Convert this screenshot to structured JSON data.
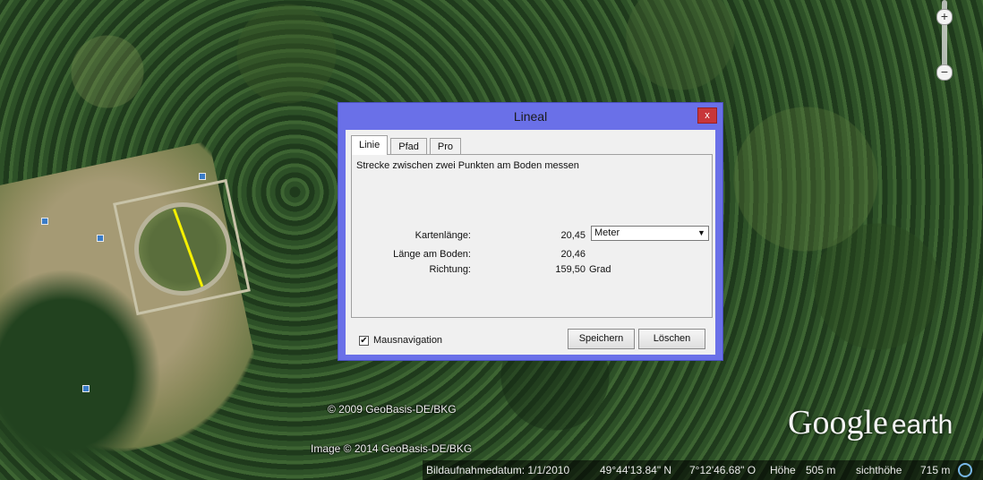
{
  "map": {
    "copyright_top": "© 2009 GeoBasis-DE/BKG",
    "copyright_image": "Image © 2014 GeoBasis-DE/BKG",
    "logo": {
      "google": "Google",
      "earth": "earth"
    },
    "zoom": {
      "in": "+",
      "out": "−"
    }
  },
  "status_bar": {
    "date": "Bildaufnahmedatum: 1/1/2010",
    "latitude": "49°44'13.84\" N",
    "longitude": "7°12'46.68\" O",
    "height_label": "Höhe",
    "height_value": "505 m",
    "eye_label": "sichthöhe",
    "eye_value": "715 m"
  },
  "dialog": {
    "title": "Lineal",
    "close": "x",
    "tabs": [
      {
        "label": "Linie",
        "active": true
      },
      {
        "label": "Pfad",
        "active": false
      },
      {
        "label": "Pro",
        "active": false
      }
    ],
    "description": "Strecke zwischen zwei Punkten am Boden messen",
    "map_length_label": "Kartenlänge:",
    "map_length_value": "20,45",
    "unit_selected": "Meter",
    "ground_length_label": "Länge am Boden:",
    "ground_length_value": "20,46",
    "direction_label": "Richtung:",
    "direction_value": "159,50",
    "direction_unit": "Grad",
    "mouse_nav_label": "Mausnavigation",
    "mouse_nav_checked": true,
    "save_label": "Speichern",
    "delete_label": "Löschen"
  },
  "colors": {
    "dialog_frame": "#6a70e8",
    "close_button": "#c8363a",
    "measure_line": "#f5f000"
  }
}
